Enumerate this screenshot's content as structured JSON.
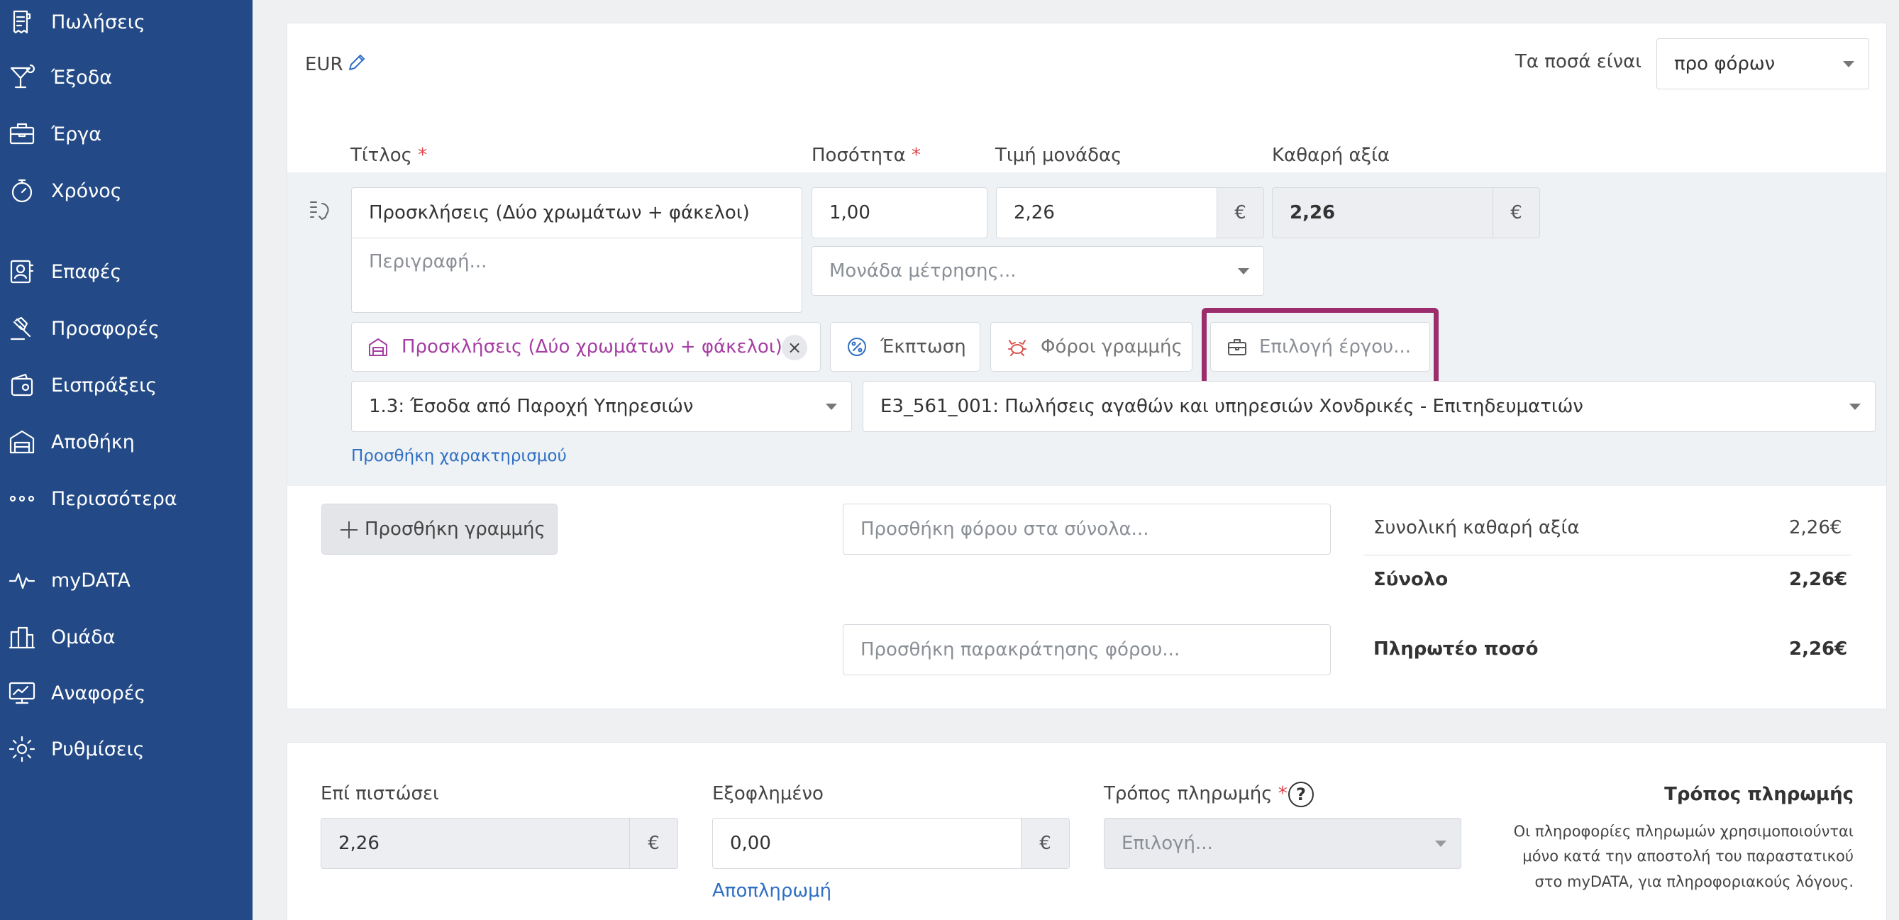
{
  "sidebar": {
    "items": [
      {
        "label": "Πωλήσεις",
        "icon": "receipt-icon"
      },
      {
        "label": "Έξοδα",
        "icon": "cocktail-icon"
      },
      {
        "label": "Έργα",
        "icon": "briefcase-icon"
      },
      {
        "label": "Χρόνος",
        "icon": "stopwatch-icon"
      },
      {
        "label": "Επαφές",
        "icon": "contact-icon"
      },
      {
        "label": "Προσφορές",
        "icon": "gavel-icon"
      },
      {
        "label": "Εισπράξεις",
        "icon": "wallet-icon"
      },
      {
        "label": "Αποθήκη",
        "icon": "warehouse-icon"
      },
      {
        "label": "Περισσότερα",
        "icon": "more-dots-icon"
      },
      {
        "label": "myDATA",
        "icon": "pulse-icon"
      },
      {
        "label": "Ομάδα",
        "icon": "team-icon"
      },
      {
        "label": "Αναφορές",
        "icon": "reports-icon"
      },
      {
        "label": "Ρυθμίσεις",
        "icon": "gear-icon"
      }
    ]
  },
  "header": {
    "currency": "EUR",
    "amounts_label": "Τα ποσά είναι",
    "amounts_value": "προ φόρων"
  },
  "line_columns": {
    "title": "Τίτλος",
    "quantity": "Ποσότητα",
    "unit_price": "Τιμή μονάδας",
    "net_value": "Καθαρή αξία",
    "required_mark": "*"
  },
  "line": {
    "title_value": "Προσκλήσεις (Δύο χρωμάτων + φάκελοι)",
    "description_placeholder": "Περιγραφή...",
    "quantity_value": "1,00",
    "unit_price_value": "2,26",
    "currency_symbol": "€",
    "net_value": "2,26",
    "unit_placeholder": "Μονάδα μέτρησης...",
    "product_chip": "Προσκλήσεις (Δύο χρωμάτων + φάκελοι)",
    "remove_symbol": "×",
    "discount_chip": "Έκπτωση",
    "taxes_chip": "Φόροι γραμμής",
    "project_chip": "Επιλογή έργου...",
    "income_category": "1.3: Έσοδα από Παροχή Υπηρεσιών",
    "income_type": "E3_561_001: Πωλήσεις αγαθών και υπηρεσιών Χονδρικές - Επιτηδευματιών",
    "add_classification": "Προσθήκη χαρακτηρισμού"
  },
  "actions": {
    "add_line": "Προσθήκη γραμμής",
    "add_tax_placeholder": "Προσθήκη φόρου στα σύνολα...",
    "add_withholding_placeholder": "Προσθήκη παρακράτησης φόρου..."
  },
  "totals": {
    "net_label": "Συνολική καθαρή αξία",
    "net_value": "2,26€",
    "total_label": "Σύνολο",
    "total_value": "2,26€",
    "payable_label": "Πληρωτέο ποσό",
    "payable_value": "2,26€"
  },
  "payment": {
    "credit_label": "Επί πιστώσει",
    "credit_value": "2,26",
    "paid_label": "Εξοφλημένο",
    "paid_value": "0,00",
    "repayment_link": "Αποπληρωμή",
    "method_label": "Τρόπος πληρωμής",
    "method_placeholder": "Επιλογή...",
    "help_symbol": "?",
    "info_title": "Τρόπος πληρωμής",
    "info_lines": [
      "Οι πληροφορίες πληρωμών χρησιμοποιούνται",
      "μόνο κατά την αποστολή του παραστατικού",
      "στο myDATA, για πληροφοριακούς λόγους."
    ]
  },
  "colors": {
    "sidebar_bg": "#234a86",
    "highlight_border": "#9b2d6c",
    "product_chip_text": "#a53fa3",
    "link": "#2f6fc4"
  }
}
